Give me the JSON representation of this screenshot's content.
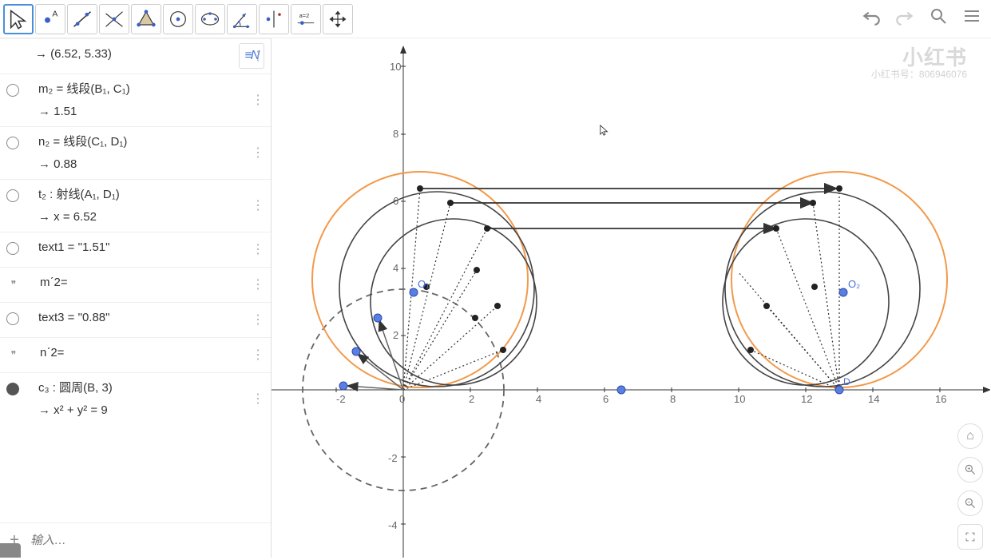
{
  "toolbar": {
    "tools": [
      {
        "name": "move-tool",
        "active": true
      },
      {
        "name": "point-tool"
      },
      {
        "name": "line-tool"
      },
      {
        "name": "perpendicular-tool"
      },
      {
        "name": "polygon-tool"
      },
      {
        "name": "circle-tool"
      },
      {
        "name": "conic-tool"
      },
      {
        "name": "angle-tool"
      },
      {
        "name": "transform-tool"
      },
      {
        "name": "slider-tool",
        "label": "a=2"
      },
      {
        "name": "move-view-tool"
      }
    ],
    "right": {
      "undo": "↶",
      "redo": "↷",
      "search": "⌕",
      "menu": "≡"
    }
  },
  "algebra": {
    "toggle_label": "≡N",
    "items": [
      {
        "marble": "none",
        "line1": "→  (6.52, 5.33)"
      },
      {
        "marble": "empty",
        "line1": "m₂ = 线段(B₁, C₁)",
        "line2": "→  1.51"
      },
      {
        "marble": "empty",
        "line1": "n₂ = 线段(C₁, D₁)",
        "line2": "→  0.88"
      },
      {
        "marble": "empty",
        "line1": "t₂ : 射线(A₁, D₁)",
        "line2": "→  x = 6.52"
      },
      {
        "marble": "empty",
        "line1": "text1 = \"1.51\""
      },
      {
        "marble": "quote",
        "line1": "mˊ2="
      },
      {
        "marble": "empty",
        "line1": "text3 = \"0.88\""
      },
      {
        "marble": "quote",
        "line1": "nˊ2="
      },
      {
        "marble": "filled",
        "line1": "c₃ : 圆周(B, 3)",
        "line2": "→  x² + y² = 9"
      }
    ],
    "input_placeholder": "输入…",
    "plus": "+"
  },
  "graphics": {
    "x_ticks": [
      -2,
      0,
      2,
      4,
      6,
      8,
      10,
      12,
      14,
      16
    ],
    "y_ticks": [
      -4,
      -2,
      2,
      4,
      6,
      8,
      10
    ],
    "labels": {
      "O1": "O₁",
      "O2": "O₂",
      "D": "D"
    }
  },
  "watermark": {
    "main": "小红书",
    "sub": "小红书号：806946076"
  },
  "chart_data": {
    "type": "geometry",
    "title": "",
    "axes": {
      "x_range": [
        -3,
        18
      ],
      "y_range": [
        -5,
        11
      ],
      "grid": false
    },
    "circles": [
      {
        "name": "c3",
        "style": "dashed",
        "color": "#666",
        "center": [
          0,
          0
        ],
        "radius": 3
      },
      {
        "name": "orange-left",
        "style": "solid",
        "color": "#f2994a",
        "center": [
          0.5,
          3.3
        ],
        "radius": 3.2
      },
      {
        "name": "orange-right",
        "style": "solid",
        "color": "#f2994a",
        "center": [
          13,
          3.3
        ],
        "radius": 3.2
      },
      {
        "name": "arc-left-1",
        "style": "solid",
        "color": "#555",
        "center": [
          1,
          3
        ],
        "radius": 2.9
      },
      {
        "name": "arc-left-2",
        "style": "solid",
        "color": "#555",
        "center": [
          1.5,
          2.6
        ],
        "radius": 2.5
      },
      {
        "name": "arc-right-1",
        "style": "solid",
        "color": "#555",
        "center": [
          12.5,
          3
        ],
        "radius": 2.9
      },
      {
        "name": "arc-right-2",
        "style": "solid",
        "color": "#555",
        "center": [
          12,
          2.6
        ],
        "radius": 2.5
      }
    ],
    "segments": [
      {
        "from": [
          0.5,
          6
        ],
        "to": [
          13,
          6
        ],
        "arrow": true
      },
      {
        "from": [
          1.4,
          5.6
        ],
        "to": [
          12.3,
          5.6
        ],
        "arrow": true
      },
      {
        "from": [
          2.5,
          4.8
        ],
        "to": [
          11.3,
          4.8
        ],
        "arrow": true
      }
    ],
    "dotted_segments": [
      {
        "from": [
          0,
          0
        ],
        "to": [
          0.5,
          6
        ]
      },
      {
        "from": [
          0,
          0
        ],
        "to": [
          1.4,
          5.6
        ]
      },
      {
        "from": [
          0,
          0
        ],
        "to": [
          2.5,
          4.8
        ]
      },
      {
        "from": [
          0,
          0
        ],
        "to": [
          2.2,
          3.6
        ]
      },
      {
        "from": [
          0,
          0
        ],
        "to": [
          2.8,
          2.5
        ]
      },
      {
        "from": [
          13,
          0
        ],
        "to": [
          13,
          6
        ]
      },
      {
        "from": [
          13,
          0
        ],
        "to": [
          12.3,
          5.6
        ]
      },
      {
        "from": [
          13,
          0
        ],
        "to": [
          11.3,
          4.8
        ]
      },
      {
        "from": [
          13,
          0
        ],
        "to": [
          10,
          3.5
        ]
      },
      {
        "from": [
          13,
          0
        ],
        "to": [
          11,
          2.5
        ]
      }
    ],
    "points": [
      {
        "name": "origin",
        "xy": [
          0,
          0
        ],
        "color": "#4a6fd9"
      },
      {
        "name": "O1",
        "xy": [
          0.5,
          3.3
        ],
        "color": "#4a6fd9"
      },
      {
        "name": "O2",
        "xy": [
          13.2,
          3.3
        ],
        "color": "#4a6fd9"
      },
      {
        "name": "D",
        "xy": [
          13,
          0
        ],
        "color": "#4a6fd9"
      },
      {
        "name": "slider",
        "xy": [
          6.5,
          0
        ],
        "color": "#4a6fd9"
      },
      {
        "name": "p-neg",
        "xy": [
          -1.8,
          0
        ],
        "color": "#4a6fd9"
      },
      {
        "name": "p-a",
        "xy": [
          -1.3,
          1.1
        ],
        "color": "#4a6fd9"
      },
      {
        "name": "p-b",
        "xy": [
          -0.6,
          2.3
        ],
        "color": "#4a6fd9"
      }
    ]
  }
}
